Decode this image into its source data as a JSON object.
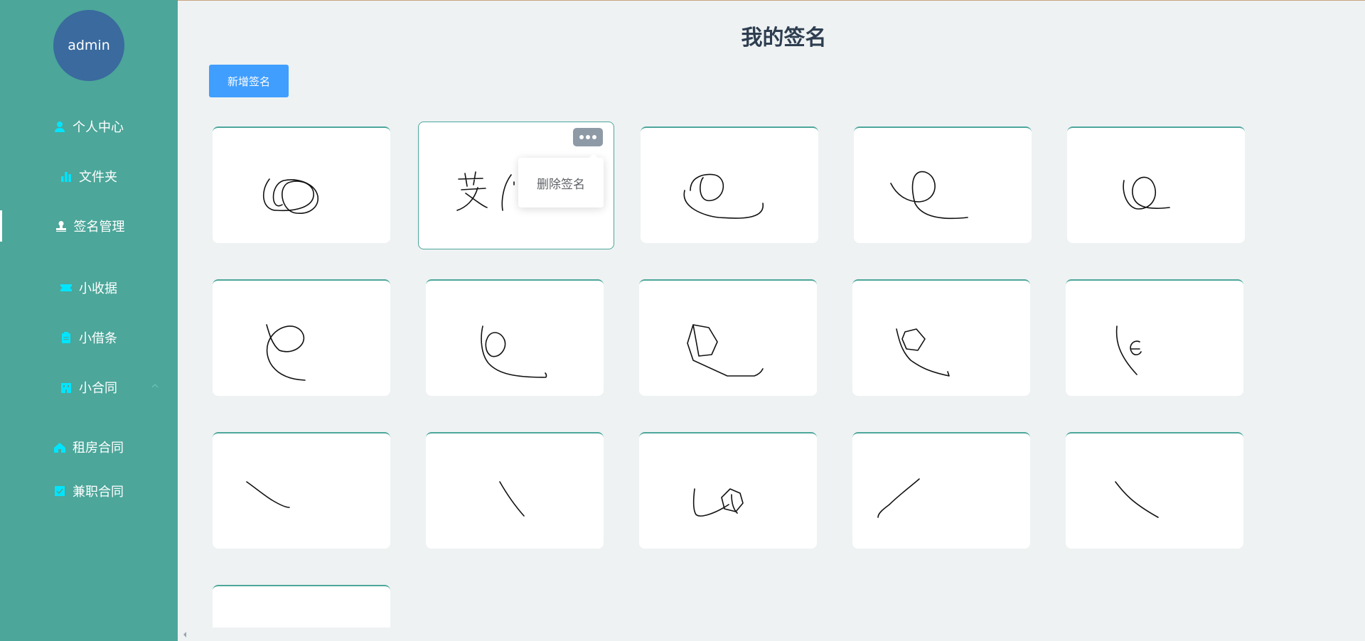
{
  "sidebar": {
    "avatar_text": "admin",
    "items": [
      {
        "label": "个人中心",
        "icon": "user-icon"
      },
      {
        "label": "文件夹",
        "icon": "bar-chart-icon"
      },
      {
        "label": "签名管理",
        "icon": "stamp-icon"
      },
      {
        "label": "小收据",
        "icon": "ticket-icon"
      },
      {
        "label": "小借条",
        "icon": "clipboard-icon"
      },
      {
        "label": "小合同",
        "icon": "building-icon"
      },
      {
        "label": "租房合同",
        "icon": "house-icon"
      },
      {
        "label": "兼职合同",
        "icon": "checklist-icon"
      }
    ],
    "active_item": "签名管理"
  },
  "header": {
    "title": "我的签名"
  },
  "toolbar": {
    "add_label": "新增签名"
  },
  "card_menu": {
    "delete_label": "删除签名"
  },
  "signatures": {
    "count_visible": 16
  },
  "colors": {
    "sidebar": "#4ca69a",
    "avatar": "#3a6a9e",
    "primary_button": "#409eff",
    "background": "#eef2f3",
    "icon": "#00e5ff"
  }
}
